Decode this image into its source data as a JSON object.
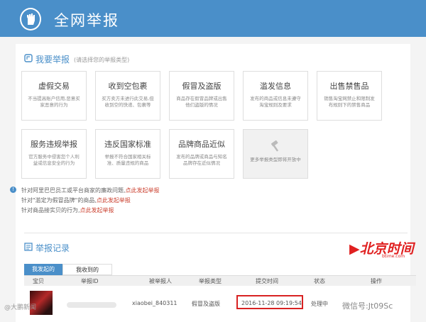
{
  "header": {
    "title": "全网举报"
  },
  "report_section": {
    "title": "我要举报",
    "subtitle": "(请选择您的举报类型)"
  },
  "categories": [
    {
      "title": "虚假交易",
      "desc": "不当提高账户信用,恶意买家恶意的行为"
    },
    {
      "title": "收到空包裹",
      "desc": "买方卖方未进行此交易,但收到空的快递、包裹等"
    },
    {
      "title": "假冒及盗版",
      "desc": "商品存在假冒品牌或出售他们盗版的情况"
    },
    {
      "title": "滥发信息",
      "desc": "发布的商品或信息未遵守淘宝规则及要求"
    },
    {
      "title": "出售禁售品",
      "desc": "销售淘宝网禁止和限制发布规则下的禁售商品"
    },
    {
      "title": "服务违规举报",
      "desc": "官方服务中侵害您个人利益或信息安全的行为"
    },
    {
      "title": "违反国家标准",
      "desc": "举报不符合国家相关标准、质量违规的商品"
    },
    {
      "title": "品牌商品近似",
      "desc": "发布的品牌或商品与知名品牌存在近似情况"
    },
    {
      "title": "",
      "desc": "更多举报类型即将开放中"
    }
  ],
  "notices": [
    {
      "text": "针对阿里巴巴员工或平台商家的廉政问题,",
      "link": "点此发起举报"
    },
    {
      "text": "针对\"滥定为假冒品牌\"的商品,",
      "link": "点此发起举报"
    },
    {
      "text": "针对商品接实贝的行为,",
      "link": "点此发起举报"
    }
  ],
  "records": {
    "title": "举报记录",
    "tabs": [
      "我发起的",
      "我收到的"
    ],
    "columns": [
      "宝贝",
      "举报ID",
      "被举报人",
      "举报类型",
      "提交时间",
      "状态",
      "操作"
    ],
    "rows": [
      {
        "reported_user": "xiaobei_840311",
        "type": "假冒及盗版",
        "time": "2016-11-28 09:19:54",
        "status": "处理中"
      }
    ]
  },
  "logo": {
    "main": "▶北京时间",
    "sub": "btime.com"
  },
  "watermarks": {
    "left": "@大鹏新闻",
    "right": "微信号:Jt09Sc"
  },
  "colors": {
    "header": "#4a8fc9",
    "accent": "#4a8fc9",
    "link": "#cc4433",
    "highlight": "#d82222"
  }
}
